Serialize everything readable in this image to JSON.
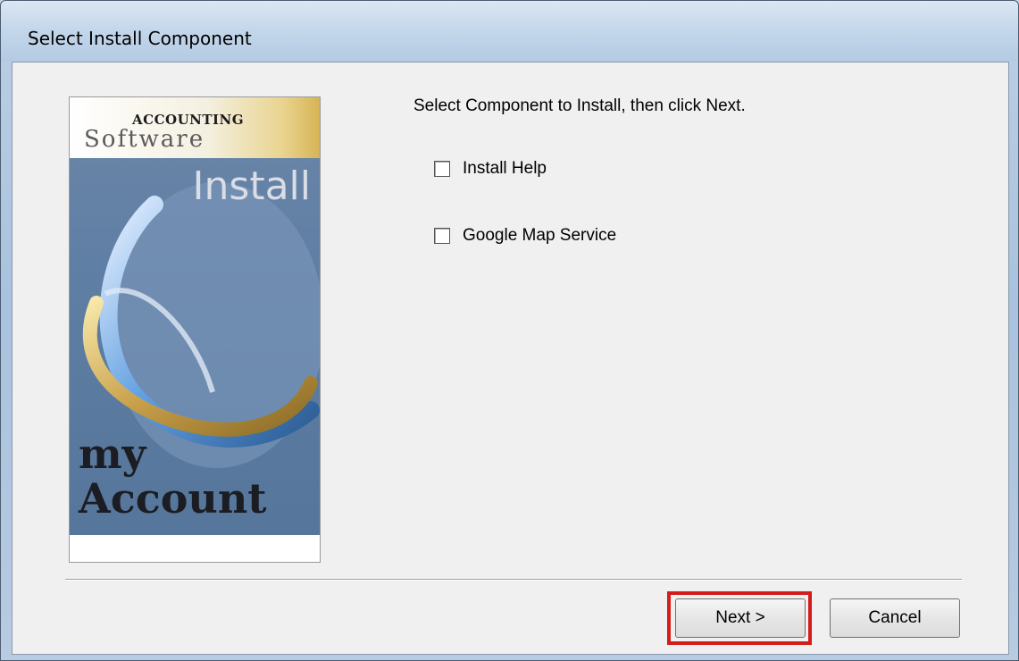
{
  "window": {
    "title": "Select Install Component"
  },
  "banner": {
    "brand_top": "ACCOUNTING",
    "brand_sub": "Software",
    "headline": "Install",
    "product_line1": "my",
    "product_line2": "Account"
  },
  "main": {
    "prompt": "Select Component to Install, then click Next.",
    "options": [
      {
        "label": "Install Help",
        "checked": false
      },
      {
        "label": "Google Map Service",
        "checked": false
      }
    ]
  },
  "buttons": {
    "next_label": "Next >",
    "cancel_label": "Cancel"
  },
  "colors": {
    "highlight": "#d41c1c"
  }
}
